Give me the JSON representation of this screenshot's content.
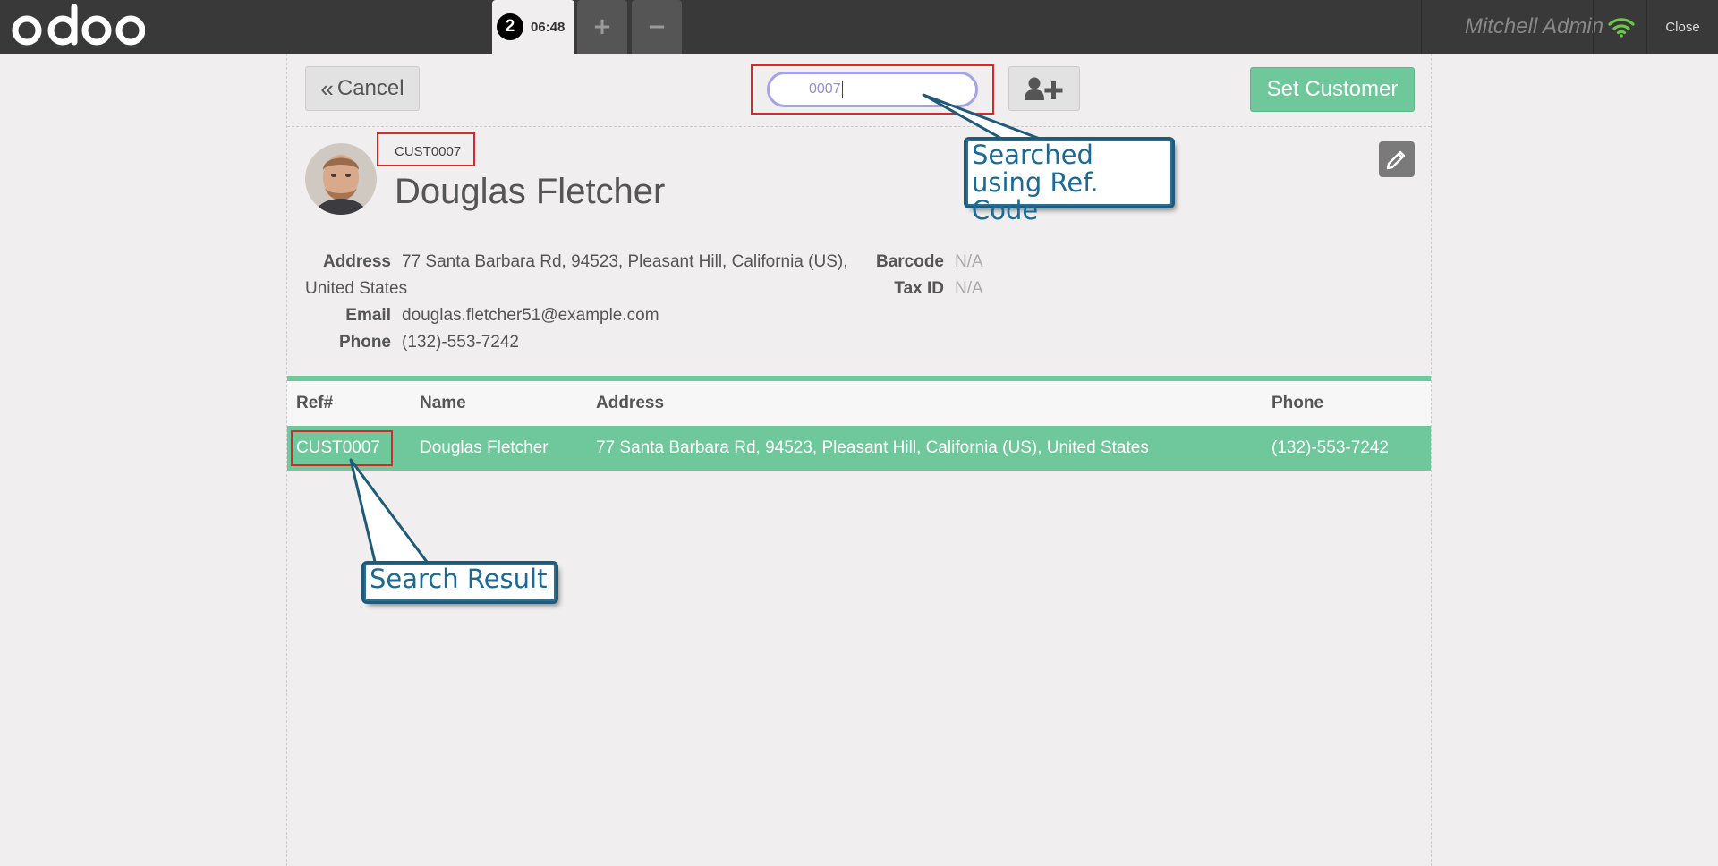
{
  "topbar": {
    "logo_text": "odoo",
    "order_number": "2",
    "order_time": "06:48",
    "add_order_label": "+",
    "remove_order_label": "−",
    "user_name": "Mitchell Admin",
    "close_label": "Close"
  },
  "header": {
    "cancel_label": "Cancel",
    "search_value": "0007",
    "set_customer_label": "Set Customer"
  },
  "customer": {
    "ref_code": "CUST0007",
    "name": "Douglas Fletcher",
    "address_label": "Address",
    "address_value": "77 Santa Barbara Rd, 94523, Pleasant Hill, California (US), United States",
    "email_label": "Email",
    "email_value": "douglas.fletcher51@example.com",
    "phone_label": "Phone",
    "phone_value": "(132)-553-7242",
    "barcode_label": "Barcode",
    "barcode_value": "N/A",
    "taxid_label": "Tax ID",
    "taxid_value": "N/A"
  },
  "table": {
    "columns": [
      "Ref#",
      "Name",
      "Address",
      "Phone"
    ],
    "rows": [
      {
        "ref": "CUST0007",
        "name": "Douglas Fletcher",
        "address": "77 Santa Barbara Rd, 94523, Pleasant Hill, California (US), United States",
        "phone": "(132)-553-7242"
      }
    ]
  },
  "annotations": {
    "search_callout": "Searched using Ref. Code",
    "result_callout": "Search Result"
  },
  "colors": {
    "topbar": "#393939",
    "accent_green": "#6ec89b",
    "annotation_red": "#d32a2a",
    "callout_blue": "#1b6a96"
  }
}
